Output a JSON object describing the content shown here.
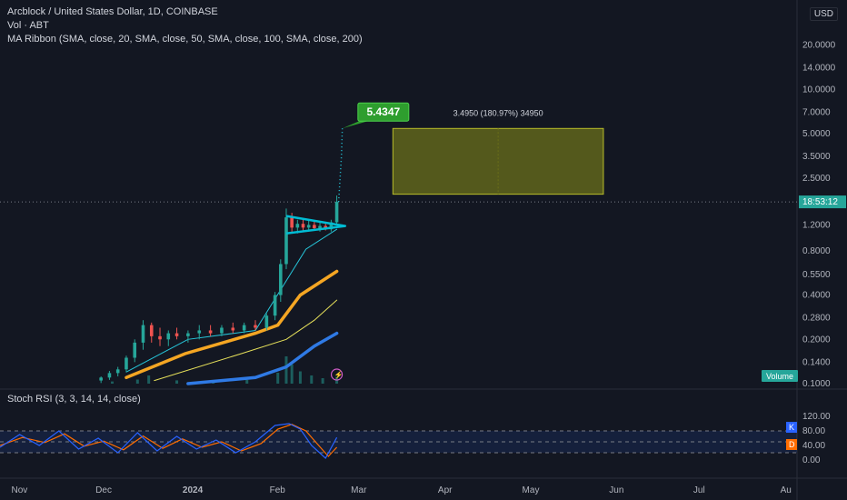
{
  "header": {
    "symbol_line": "Arcblock / United States Dollar, 1D, COINBASE",
    "vol_line": "Vol · ABT",
    "ma_line": "MA Ribbon (SMA, close, 20, SMA, close, 50, SMA, close, 100, SMA, close, 200)",
    "currency": "USD"
  },
  "price_axis": {
    "labels": [
      "20.0000",
      "14.0000",
      "10.0000",
      "7.0000",
      "5.0000",
      "3.5000",
      "2.5000",
      "1.7000",
      "1.2000",
      "0.8000",
      "0.5500",
      "0.4000",
      "0.2800",
      "0.2000",
      "0.1400",
      "0.1000"
    ],
    "countdown": "18:53:12",
    "volume_badge": "Volume"
  },
  "rsi_panel": {
    "title": "Stoch RSI (3, 3, 14, 14, close)",
    "axis_labels": [
      "120.00",
      "80.00",
      "40.00",
      "0.00"
    ],
    "k_label": "K",
    "d_label": "D"
  },
  "time_axis": {
    "labels": [
      "Nov",
      "Dec",
      "2024",
      "Feb",
      "Mar",
      "Apr",
      "May",
      "Jun",
      "Jul",
      "Au"
    ]
  },
  "annotations": {
    "target_label": "5.4347",
    "range_label": "3.4950 (180.97%) 34950"
  },
  "colors": {
    "background": "#131722",
    "up": "#26a69a",
    "down": "#ef5350",
    "ma20": "#26c6da",
    "ma50": "#f5a623",
    "ma100": "#e6e05a",
    "ma200": "#2f7ae5",
    "triangle": "#00bcd4",
    "target_box": "#8a8f17",
    "label_green": "#2e9e2e",
    "k_line": "#2962ff",
    "d_line": "#ff6d00"
  },
  "chart_data": {
    "type": "candlestick",
    "scale": "log",
    "ylim": [
      0.1,
      25
    ],
    "x_start": "2023-10-26",
    "x_end": "2024-08-05",
    "last_close": 1.72,
    "target": 5.4347,
    "target_box": {
      "from": "2024-03-14",
      "to": "2024-05-28",
      "low": 1.94,
      "high": 5.43
    },
    "pennant": {
      "start": "2024-02-05",
      "apex": "2024-02-26",
      "top": 1.38,
      "bottom": 1.05,
      "apex_value": 1.18
    },
    "candles": [
      {
        "d": "2023-12-01",
        "o": 0.105,
        "h": 0.112,
        "l": 0.101,
        "c": 0.11
      },
      {
        "d": "2023-12-04",
        "o": 0.11,
        "h": 0.122,
        "l": 0.106,
        "c": 0.118
      },
      {
        "d": "2023-12-07",
        "o": 0.118,
        "h": 0.13,
        "l": 0.112,
        "c": 0.125
      },
      {
        "d": "2023-12-10",
        "o": 0.125,
        "h": 0.155,
        "l": 0.12,
        "c": 0.15
      },
      {
        "d": "2023-12-13",
        "o": 0.15,
        "h": 0.2,
        "l": 0.14,
        "c": 0.19
      },
      {
        "d": "2023-12-16",
        "o": 0.19,
        "h": 0.27,
        "l": 0.17,
        "c": 0.25
      },
      {
        "d": "2023-12-19",
        "o": 0.25,
        "h": 0.26,
        "l": 0.19,
        "c": 0.21
      },
      {
        "d": "2023-12-22",
        "o": 0.21,
        "h": 0.24,
        "l": 0.18,
        "c": 0.2
      },
      {
        "d": "2023-12-25",
        "o": 0.2,
        "h": 0.23,
        "l": 0.18,
        "c": 0.22
      },
      {
        "d": "2023-12-28",
        "o": 0.22,
        "h": 0.24,
        "l": 0.2,
        "c": 0.21
      },
      {
        "d": "2024-01-01",
        "o": 0.21,
        "h": 0.23,
        "l": 0.19,
        "c": 0.22
      },
      {
        "d": "2024-01-05",
        "o": 0.22,
        "h": 0.25,
        "l": 0.2,
        "c": 0.23
      },
      {
        "d": "2024-01-09",
        "o": 0.23,
        "h": 0.25,
        "l": 0.21,
        "c": 0.22
      },
      {
        "d": "2024-01-13",
        "o": 0.22,
        "h": 0.25,
        "l": 0.21,
        "c": 0.24
      },
      {
        "d": "2024-01-17",
        "o": 0.24,
        "h": 0.26,
        "l": 0.22,
        "c": 0.23
      },
      {
        "d": "2024-01-21",
        "o": 0.23,
        "h": 0.26,
        "l": 0.22,
        "c": 0.25
      },
      {
        "d": "2024-01-25",
        "o": 0.25,
        "h": 0.27,
        "l": 0.23,
        "c": 0.24
      },
      {
        "d": "2024-01-29",
        "o": 0.24,
        "h": 0.3,
        "l": 0.23,
        "c": 0.29
      },
      {
        "d": "2024-02-01",
        "o": 0.29,
        "h": 0.42,
        "l": 0.27,
        "c": 0.4
      },
      {
        "d": "2024-02-03",
        "o": 0.4,
        "h": 0.7,
        "l": 0.36,
        "c": 0.65
      },
      {
        "d": "2024-02-05",
        "o": 0.65,
        "h": 1.55,
        "l": 0.6,
        "c": 1.35
      },
      {
        "d": "2024-02-07",
        "o": 1.35,
        "h": 1.45,
        "l": 1.05,
        "c": 1.15
      },
      {
        "d": "2024-02-09",
        "o": 1.15,
        "h": 1.3,
        "l": 1.05,
        "c": 1.22
      },
      {
        "d": "2024-02-11",
        "o": 1.22,
        "h": 1.32,
        "l": 1.1,
        "c": 1.15
      },
      {
        "d": "2024-02-13",
        "o": 1.15,
        "h": 1.28,
        "l": 1.08,
        "c": 1.2
      },
      {
        "d": "2024-02-15",
        "o": 1.2,
        "h": 1.27,
        "l": 1.1,
        "c": 1.14
      },
      {
        "d": "2024-02-17",
        "o": 1.14,
        "h": 1.25,
        "l": 1.08,
        "c": 1.18
      },
      {
        "d": "2024-02-19",
        "o": 1.18,
        "h": 1.24,
        "l": 1.1,
        "c": 1.12
      },
      {
        "d": "2024-02-21",
        "o": 1.12,
        "h": 1.3,
        "l": 1.08,
        "c": 1.25
      },
      {
        "d": "2024-02-23",
        "o": 1.25,
        "h": 1.9,
        "l": 1.2,
        "c": 1.72
      }
    ],
    "ma20": [
      [
        "2023-12-10",
        0.12
      ],
      [
        "2024-01-01",
        0.2
      ],
      [
        "2024-01-25",
        0.23
      ],
      [
        "2024-02-05",
        0.5
      ],
      [
        "2024-02-12",
        0.82
      ],
      [
        "2024-02-23",
        1.12
      ]
    ],
    "ma50": [
      [
        "2023-12-10",
        0.11
      ],
      [
        "2023-12-31",
        0.16
      ],
      [
        "2024-01-25",
        0.22
      ],
      [
        "2024-02-02",
        0.25
      ],
      [
        "2024-02-10",
        0.4
      ],
      [
        "2024-02-23",
        0.58
      ]
    ],
    "ma100": [
      [
        "2023-12-20",
        0.105
      ],
      [
        "2024-01-20",
        0.16
      ],
      [
        "2024-02-05",
        0.2
      ],
      [
        "2024-02-15",
        0.27
      ],
      [
        "2024-02-23",
        0.37
      ]
    ],
    "ma200": [
      [
        "2024-01-01",
        0.1
      ],
      [
        "2024-01-25",
        0.11
      ],
      [
        "2024-02-05",
        0.13
      ],
      [
        "2024-02-15",
        0.18
      ],
      [
        "2024-02-23",
        0.22
      ]
    ],
    "stoch_k": [
      [
        "2023-10-26",
        35
      ],
      [
        "2023-11-02",
        70
      ],
      [
        "2023-11-09",
        40
      ],
      [
        "2023-11-16",
        80
      ],
      [
        "2023-11-23",
        30
      ],
      [
        "2023-11-30",
        60
      ],
      [
        "2023-12-07",
        20
      ],
      [
        "2023-12-14",
        75
      ],
      [
        "2023-12-21",
        25
      ],
      [
        "2023-12-28",
        65
      ],
      [
        "2024-01-04",
        30
      ],
      [
        "2024-01-11",
        55
      ],
      [
        "2024-01-18",
        20
      ],
      [
        "2024-01-25",
        50
      ],
      [
        "2024-02-01",
        95
      ],
      [
        "2024-02-06",
        100
      ],
      [
        "2024-02-10",
        85
      ],
      [
        "2024-02-14",
        40
      ],
      [
        "2024-02-19",
        5
      ],
      [
        "2024-02-23",
        62
      ]
    ],
    "stoch_d": [
      [
        "2023-10-26",
        40
      ],
      [
        "2023-11-03",
        62
      ],
      [
        "2023-11-11",
        48
      ],
      [
        "2023-11-18",
        72
      ],
      [
        "2023-11-25",
        38
      ],
      [
        "2023-12-02",
        52
      ],
      [
        "2023-12-09",
        28
      ],
      [
        "2023-12-16",
        66
      ],
      [
        "2023-12-23",
        32
      ],
      [
        "2023-12-30",
        58
      ],
      [
        "2024-01-06",
        35
      ],
      [
        "2024-01-13",
        50
      ],
      [
        "2024-01-20",
        25
      ],
      [
        "2024-01-27",
        45
      ],
      [
        "2024-02-02",
        85
      ],
      [
        "2024-02-07",
        98
      ],
      [
        "2024-02-12",
        80
      ],
      [
        "2024-02-16",
        45
      ],
      [
        "2024-02-20",
        10
      ],
      [
        "2024-02-23",
        35
      ]
    ],
    "volume": [
      [
        "2023-12-05",
        8
      ],
      [
        "2023-12-14",
        15
      ],
      [
        "2023-12-18",
        30
      ],
      [
        "2023-12-28",
        12
      ],
      [
        "2024-01-10",
        10
      ],
      [
        "2024-01-22",
        14
      ],
      [
        "2024-02-02",
        40
      ],
      [
        "2024-02-05",
        100
      ],
      [
        "2024-02-07",
        70
      ],
      [
        "2024-02-10",
        45
      ],
      [
        "2024-02-14",
        30
      ],
      [
        "2024-02-18",
        20
      ],
      [
        "2024-02-23",
        25
      ]
    ]
  }
}
